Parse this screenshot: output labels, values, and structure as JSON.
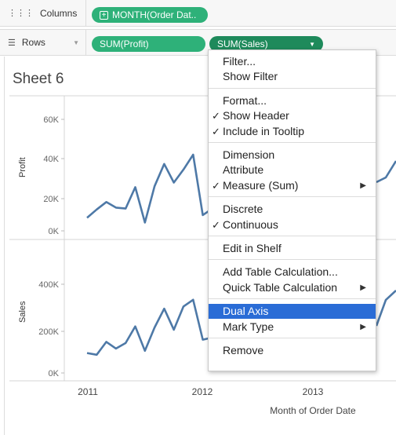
{
  "shelves": {
    "columns": {
      "label": "Columns",
      "icon": "columns-icon",
      "pills": [
        {
          "label": "MONTH(Order Dat.."
        }
      ]
    },
    "rows": {
      "label": "Rows",
      "icon": "rows-icon",
      "pills": [
        {
          "label": "SUM(Profit)"
        },
        {
          "label": "SUM(Sales)"
        }
      ]
    }
  },
  "sheet": {
    "title": "Sheet 6"
  },
  "chart_data": {
    "type": "line",
    "xlabel": "Month of Order Date",
    "x_ticks": [
      "2011",
      "2012",
      "2013"
    ],
    "series": [
      {
        "name": "Profit",
        "ylabel": "Profit",
        "y_ticks": [
          "60K",
          "40K",
          "20K",
          "0K"
        ],
        "ylim": [
          0,
          70000
        ],
        "values": [
          7000,
          11500,
          15500,
          12500,
          12000,
          23500,
          4500,
          24000,
          36000,
          26000,
          33000,
          41000,
          8500,
          12000
        ]
      },
      {
        "name": "Sales",
        "ylabel": "Sales",
        "y_ticks": [
          "400K",
          "200K",
          "0K"
        ],
        "ylim": [
          0,
          500000
        ],
        "values": [
          90000,
          82000,
          140000,
          110000,
          135000,
          210000,
          100000,
          205000,
          290000,
          195000,
          300000,
          330000,
          150000,
          160000
        ]
      }
    ],
    "color": "#4e79a7"
  },
  "menu": {
    "groups": [
      [
        {
          "label": "Filter..."
        },
        {
          "label": "Show Filter"
        }
      ],
      [
        {
          "label": "Format..."
        },
        {
          "label": "Show Header",
          "checked": true
        },
        {
          "label": "Include in Tooltip",
          "checked": true
        }
      ],
      [
        {
          "label": "Dimension"
        },
        {
          "label": "Attribute"
        },
        {
          "label": "Measure (Sum)",
          "checked": true,
          "submenu": true
        }
      ],
      [
        {
          "label": "Discrete"
        },
        {
          "label": "Continuous",
          "checked": true
        }
      ],
      [
        {
          "label": "Edit in Shelf"
        }
      ],
      [
        {
          "label": "Add Table Calculation..."
        },
        {
          "label": "Quick Table Calculation",
          "submenu": true
        }
      ],
      [
        {
          "label": "Dual Axis",
          "highlighted": true
        },
        {
          "label": "Mark Type",
          "submenu": true
        }
      ],
      [
        {
          "label": "Remove"
        }
      ]
    ]
  }
}
